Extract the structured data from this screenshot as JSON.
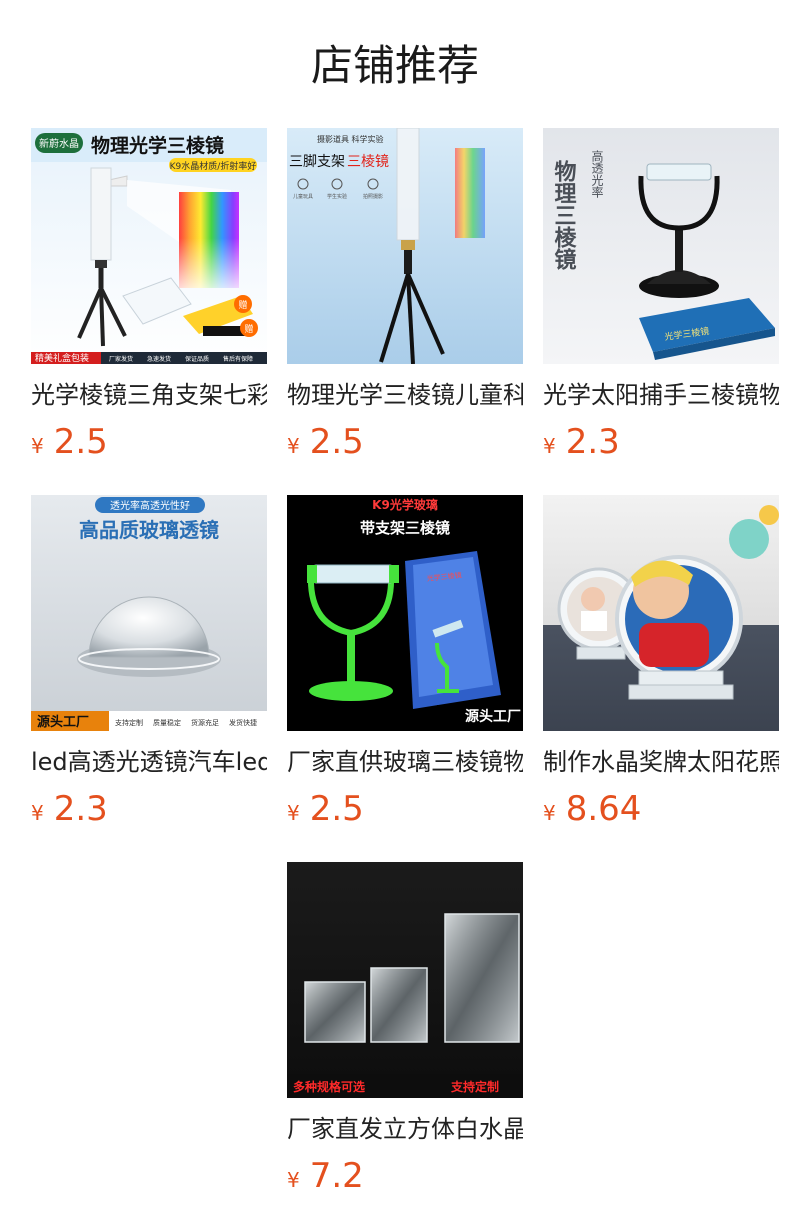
{
  "header": {
    "title": "店铺推荐"
  },
  "products": [
    {
      "name": "光学棱镜三角支架七彩",
      "currency": "¥",
      "price": "2.5",
      "image_text": {
        "brand": "新蔚水晶",
        "headline": "物理光学三棱镜",
        "sub": "K9水晶材质/折射率好",
        "footer": [
          "精美礼盒包装",
          "厂家发货",
          "急速发货",
          "保证品质",
          "售后有保障"
        ],
        "badges": [
          "赠",
          "赠"
        ]
      }
    },
    {
      "name": "物理光学三棱镜儿童科",
      "currency": "¥",
      "price": "2.5",
      "image_text": {
        "top": "摄影道具 科学实验",
        "headline_a": "三脚支架",
        "headline_b": "三棱镜",
        "icons": [
          "儿童玩具",
          "学生实验",
          "拍照摄影"
        ]
      }
    },
    {
      "name": "光学太阳捕手三棱镜物",
      "currency": "¥",
      "price": "2.3",
      "image_text": {
        "vertical_big": "物理三棱镜",
        "vertical_small": "高透光率",
        "box_label": "光学三棱镜"
      }
    },
    {
      "name": "led高透光透镜汽车led",
      "currency": "¥",
      "price": "2.3",
      "image_text": {
        "pill": "透光率高透光性好",
        "headline": "高品质玻璃透镜",
        "footer_main": "源头工厂",
        "footer": [
          "支持定制",
          "质量稳定",
          "货源充足",
          "发货快捷"
        ]
      }
    },
    {
      "name": "厂家直供玻璃三棱镜物",
      "currency": "¥",
      "price": "2.5",
      "image_text": {
        "top": "K9光学玻璃",
        "headline": "带支架三棱镜",
        "box_label": "光学三棱镜",
        "footer": "源头工厂"
      }
    },
    {
      "name": "制作水晶奖牌太阳花照",
      "currency": "¥",
      "price": "8.64",
      "image_text": {}
    },
    {
      "name": "厂家直发立方体白水晶",
      "currency": "¥",
      "price": "7.2",
      "image_text": {
        "footer_left": "多种规格可选",
        "footer_right": "支持定制"
      }
    }
  ],
  "colors": {
    "price": "#e4501e",
    "title": "#1a1a1a",
    "name": "#222222"
  }
}
